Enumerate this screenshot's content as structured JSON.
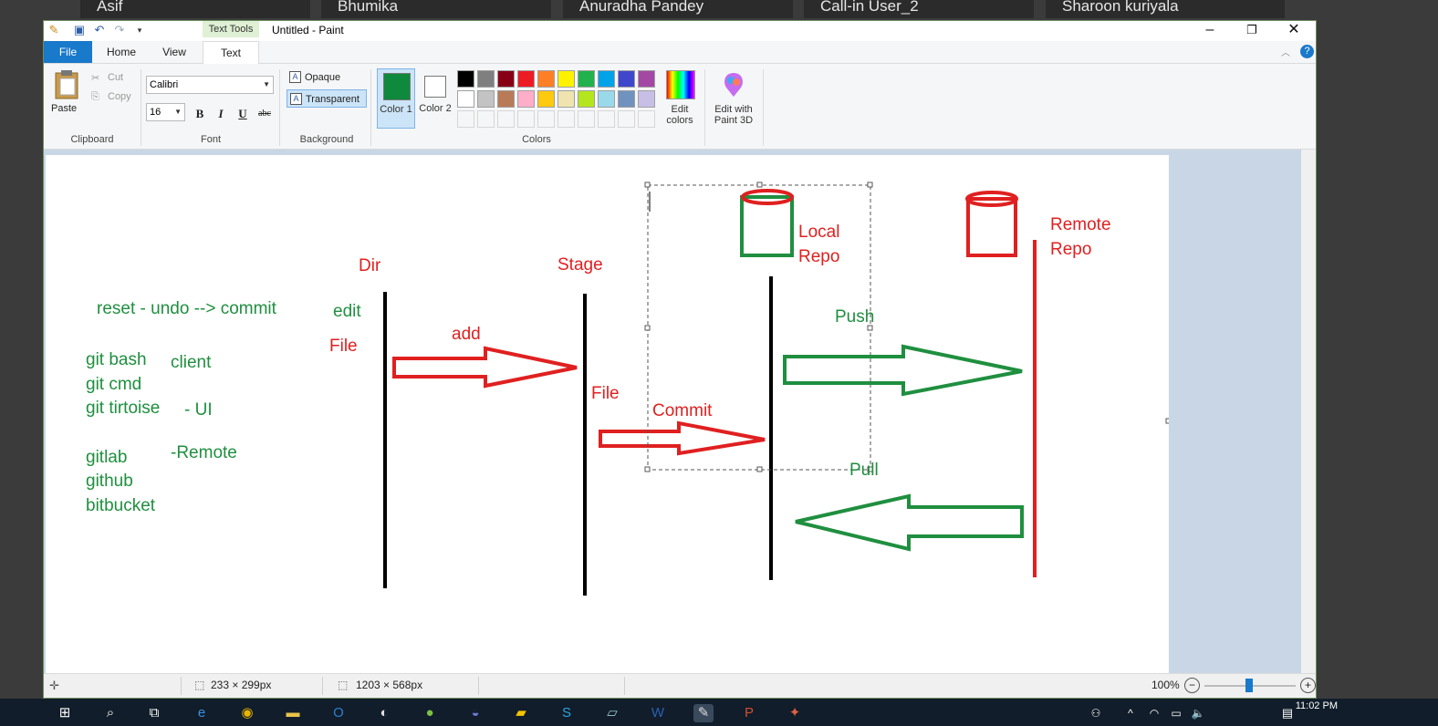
{
  "participants": [
    "Asif",
    "Bhumika",
    "Anuradha Pandey",
    "Call-in User_2",
    "Sharoon kuriyala"
  ],
  "window": {
    "title": "Untitled - Paint",
    "context_tab": "Text Tools",
    "minimize_icon": "minimize-icon",
    "restore_icon": "restore-icon",
    "close_icon": "close-icon"
  },
  "tabs": [
    "File",
    "Home",
    "View",
    "Text"
  ],
  "active_tab": "Text",
  "ribbon": {
    "clipboard": {
      "paste": "Paste",
      "cut": "Cut",
      "copy": "Copy",
      "group": "Clipboard"
    },
    "font": {
      "family": "Calibri",
      "size": "16",
      "bold": "B",
      "italic": "I",
      "underline": "U",
      "strike": "abc",
      "group": "Font"
    },
    "background": {
      "opaque": "Opaque",
      "transparent": "Transparent",
      "group": "Background"
    },
    "colors": {
      "color1_label": "Color 1",
      "color2_label": "Color 2",
      "color1": "#0f8a3c",
      "color2": "#ffffff",
      "edit_colors": "Edit colors",
      "edit_paint3d": "Edit with Paint 3D",
      "group": "Colors",
      "palette_row1": [
        "#000000",
        "#7f7f7f",
        "#880015",
        "#ed1c24",
        "#ff7f27",
        "#fff200",
        "#22b14c",
        "#00a2e8",
        "#3f48cc",
        "#a349a4"
      ],
      "palette_row2": [
        "#ffffff",
        "#c3c3c3",
        "#b97a57",
        "#ffaec9",
        "#ffc90e",
        "#efe4b0",
        "#b5e61d",
        "#99d9ea",
        "#7092be",
        "#c8bfe7"
      ]
    }
  },
  "drawing": {
    "left_notes": [
      "reset - undo --> commit",
      "git bash",
      "client",
      "git cmd",
      "git tirtoise",
      "- UI",
      "gitlab",
      "-Remote",
      "github",
      "bitbucket"
    ],
    "dir_label": "Dir",
    "edit_label": "edit",
    "file_label_1": "File",
    "add_label": "add",
    "stage_label": "Stage",
    "file_label_2": "File",
    "commit_label": "Commit",
    "local_repo_label": [
      "Local",
      "Repo"
    ],
    "push_label": "Push",
    "pull_label": "Pull",
    "remote_repo_label": [
      "Remote",
      "Repo"
    ],
    "colors": {
      "green": "#1f8f3f",
      "red": "#e02020",
      "black": "#000000"
    }
  },
  "status": {
    "selection_size": "233 × 299px",
    "canvas_size": "1203 × 568px",
    "zoom": "100%"
  },
  "taskbar": {
    "time": "11:02 PM"
  }
}
